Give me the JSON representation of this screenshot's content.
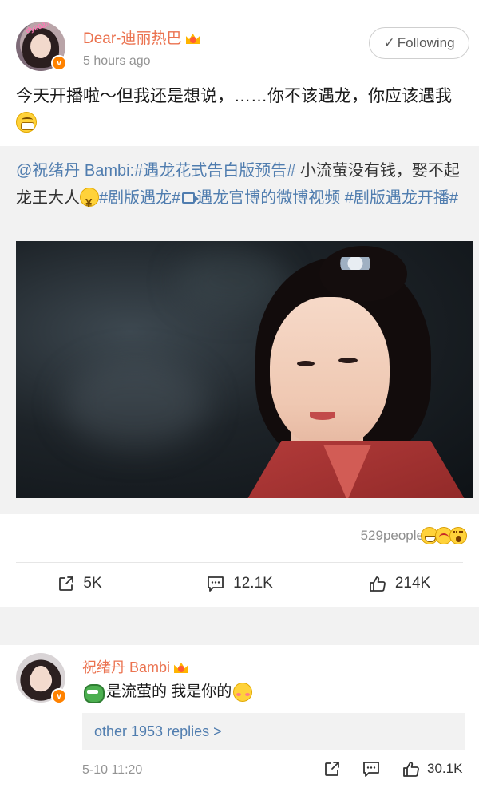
{
  "post": {
    "username": "Dear-迪丽热巴",
    "avatar_text": "dy2020",
    "time": "5 hours ago",
    "follow_label": "Following",
    "text": "今天开播啦～但我还是想说，……你不该遇龙，你应该遇我",
    "repost": {
      "author": "@祝绪丹 Bambi:",
      "tag1": "#遇龙花式告白版预告#",
      "plain1": " 小流萤没有钱，娶不起龙王大人",
      "tag2": "#剧版遇龙#",
      "video_link": "遇龙官博的微博视频",
      "tag3": " #剧版遇龙开播#"
    },
    "reactions": {
      "people": "529people"
    },
    "actions": {
      "share": "5K",
      "comment": "12.1K",
      "like": "214K"
    }
  },
  "comment": {
    "username": "祝绪丹 Bambi",
    "text": "是流萤的 我是你的",
    "replies_link": "other 1953 replies >",
    "date": "5-10 11:20",
    "likes": "30.1K"
  },
  "colors": {
    "accent": "#eb7350",
    "link": "#507daf",
    "verified": "#ff8200"
  }
}
